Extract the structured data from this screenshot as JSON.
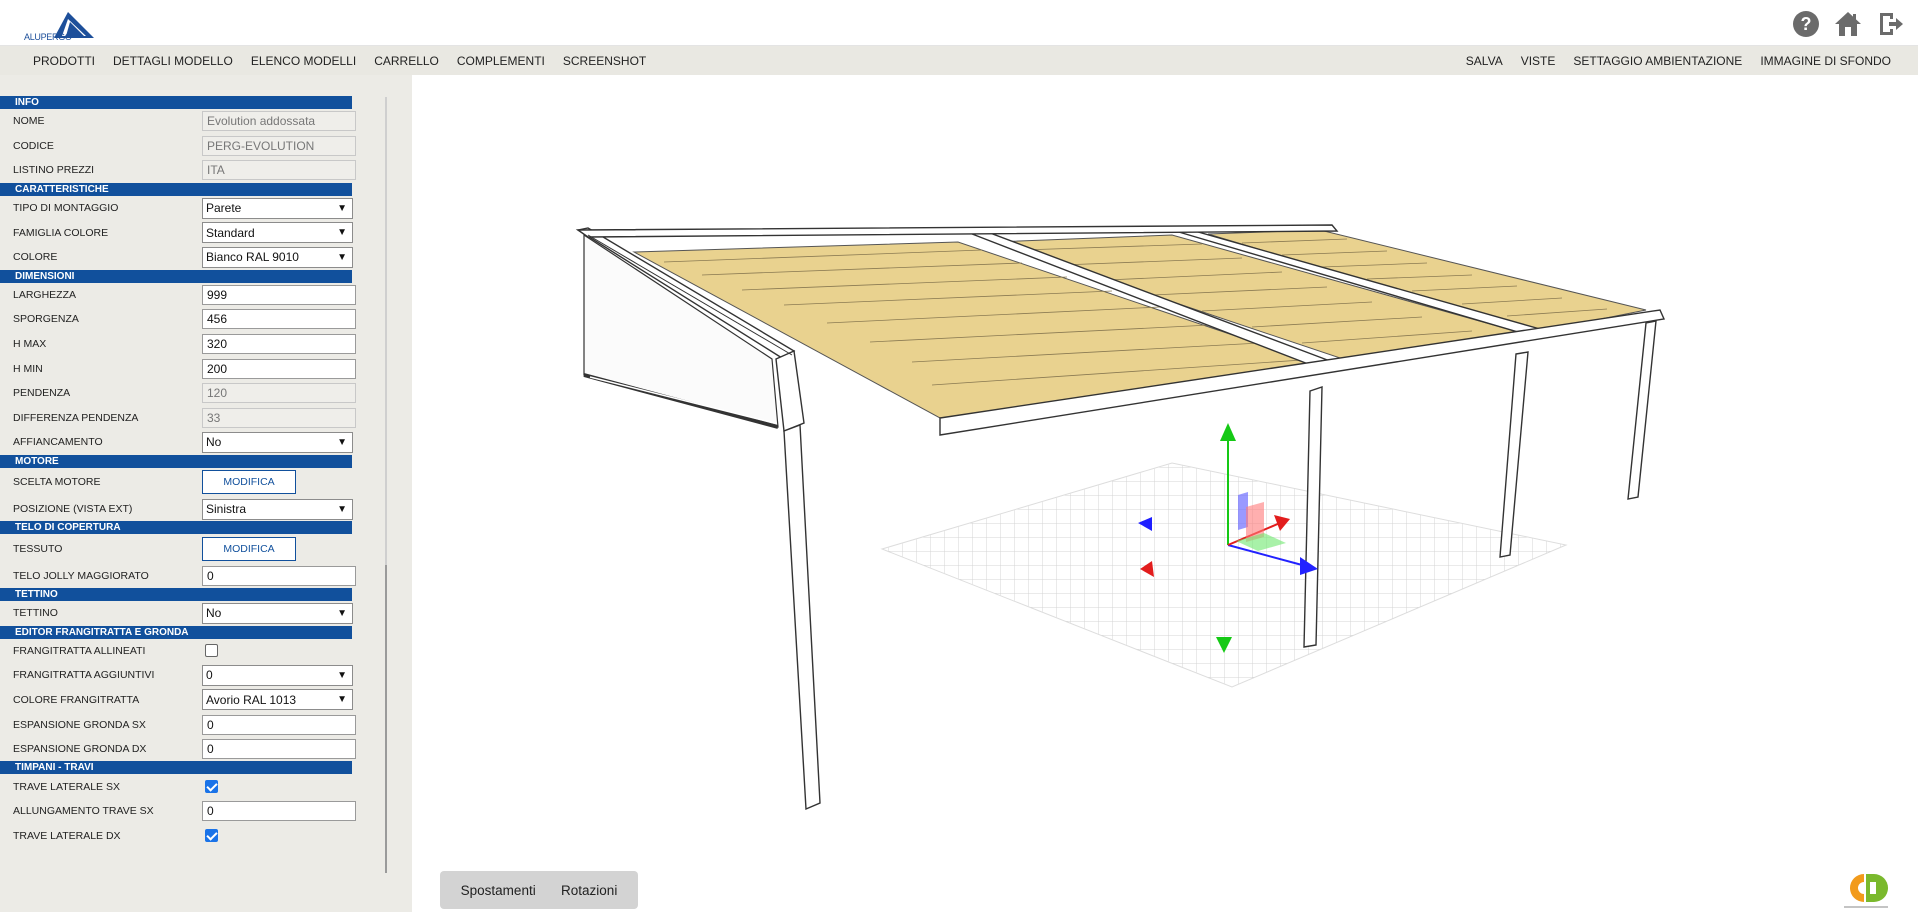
{
  "app": {
    "logo_text": "ALUPERGO",
    "top_icons": [
      "help-icon",
      "home-icon",
      "logout-icon"
    ]
  },
  "menu": {
    "left": [
      "PRODOTTI",
      "DETTAGLI MODELLO",
      "ELENCO MODELLI",
      "CARRELLO",
      "COMPLEMENTI",
      "SCREENSHOT"
    ],
    "right": [
      "SALVA",
      "VISTE",
      "SETTAGGIO AMBIENTAZIONE",
      "IMMAGINE DI SFONDO"
    ]
  },
  "sections": {
    "info": "INFO",
    "caratteristiche": "CARATTERISTICHE",
    "dimensioni": "DIMENSIONI",
    "motore": "MOTORE",
    "telo": "TELO DI COPERTURA",
    "tettino": "TETTINO",
    "editor": "EDITOR FRANGITRATTA E GRONDA",
    "timpani": "TIMPANI - TRAVI"
  },
  "fields": {
    "nome": {
      "label": "NOME",
      "value": "Evolution addossata"
    },
    "codice": {
      "label": "CODICE",
      "value": "PERG-EVOLUTION"
    },
    "listino": {
      "label": "LISTINO PREZZI",
      "value": "ITA"
    },
    "tipo_montaggio": {
      "label": "TIPO DI MONTAGGIO",
      "value": "Parete"
    },
    "famiglia_colore": {
      "label": "FAMIGLIA COLORE",
      "value": "Standard"
    },
    "colore": {
      "label": "COLORE",
      "value": "Bianco RAL 9010"
    },
    "larghezza": {
      "label": "LARGHEZZA",
      "value": "999"
    },
    "sporgenza": {
      "label": "SPORGENZA",
      "value": "456"
    },
    "h_max": {
      "label": "H MAX",
      "value": "320"
    },
    "h_min": {
      "label": "H MIN",
      "value": "200"
    },
    "pendenza": {
      "label": "PENDENZA",
      "value": "120"
    },
    "diff_pendenza": {
      "label": "DIFFERENZA PENDENZA",
      "value": "33"
    },
    "affiancamento": {
      "label": "AFFIANCAMENTO",
      "value": "No"
    },
    "scelta_motore": {
      "label": "SCELTA MOTORE",
      "button": "MODIFICA"
    },
    "posizione": {
      "label": "POSIZIONE (VISTA EXT)",
      "value": "Sinistra"
    },
    "tessuto": {
      "label": "TESSUTO",
      "button": "MODIFICA"
    },
    "telo_jolly": {
      "label": "TELO JOLLY MAGGIORATO",
      "value": "0"
    },
    "tettino": {
      "label": "TETTINO",
      "value": "No"
    },
    "frangitratta_allineati": {
      "label": "FRANGITRATTA ALLINEATI",
      "checked": false
    },
    "frangitratta_aggiuntivi": {
      "label": "FRANGITRATTA AGGIUNTIVI",
      "value": "0"
    },
    "colore_frangitratta": {
      "label": "COLORE FRANGITRATTA",
      "value": "Avorio RAL 1013"
    },
    "espansione_sx": {
      "label": "ESPANSIONE GRONDA SX",
      "value": "0"
    },
    "espansione_dx": {
      "label": "ESPANSIONE GRONDA DX",
      "value": "0"
    },
    "trave_sx": {
      "label": "TRAVE LATERALE SX",
      "checked": true
    },
    "allungamento_sx": {
      "label": "ALLUNGAMENTO TRAVE SX",
      "value": "0"
    },
    "trave_dx": {
      "label": "TRAVE LATERALE DX",
      "checked": true
    }
  },
  "viewport": {
    "tabs": [
      "Spostamenti",
      "Rotazioni"
    ]
  },
  "colors": {
    "section_bg": "#11509c",
    "fabric": "#e9d28f",
    "menubar": "#e9e8e2"
  }
}
